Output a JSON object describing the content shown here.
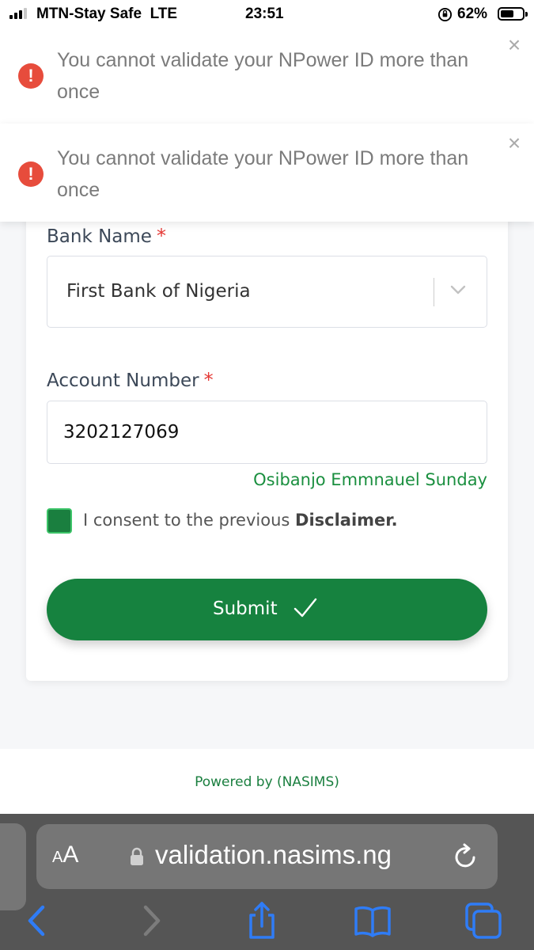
{
  "status_bar": {
    "carrier": "MTN-Stay Safe",
    "network": "LTE",
    "time": "23:51",
    "battery_percent": "62%",
    "battery_level": 0.62,
    "signal_bars": 3,
    "icons": [
      "signal-icon",
      "orientation-lock-icon",
      "battery-icon"
    ]
  },
  "toasts": [
    {
      "message": "You cannot validate your NPower ID more than once",
      "icon": "error-icon",
      "close": "×"
    },
    {
      "message": "You cannot validate your NPower ID more than once",
      "icon": "error-icon",
      "close": "×"
    }
  ],
  "form": {
    "bank_label": "Bank Name",
    "bank_required": "*",
    "bank_value": "First Bank of Nigeria",
    "account_label": "Account Number",
    "account_required": "*",
    "account_value": "3202127069",
    "account_name": "Osibanjo Emmnauel Sunday",
    "consent_prefix": "I consent to the previous ",
    "consent_link": "Disclaimer.",
    "consent_checked": true,
    "submit_label": "Submit"
  },
  "footer": {
    "powered_by": "Powered by (NASIMS)"
  },
  "browser": {
    "text_size_label_small": "A",
    "text_size_label_large": "A",
    "url": "validation.nasims.ng",
    "toolbar": [
      "back-icon",
      "forward-icon",
      "share-icon",
      "bookmarks-icon",
      "tabs-icon"
    ]
  },
  "colors": {
    "brand_green": "#16823f",
    "account_name_green": "#1a8f3f",
    "error_red": "#e74c3c",
    "required_red": "#e53935",
    "safari_blue": "#2f7cf6"
  }
}
